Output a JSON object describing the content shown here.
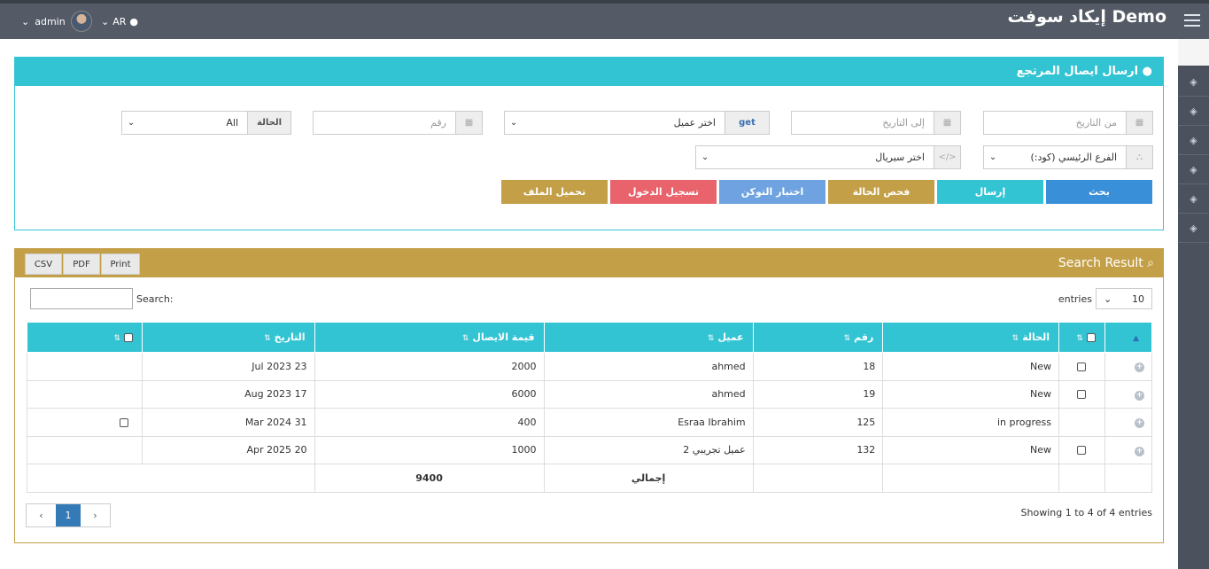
{
  "header": {
    "brand": "إيكاد سوفت Demo",
    "user": "admin",
    "lang": "AR"
  },
  "form": {
    "title": "ارسال ايصال المرتجع",
    "from_date_placeholder": "من التاريخ",
    "to_date_placeholder": "إلى التاريخ",
    "client_select": "اختر عميل",
    "get_label": "get",
    "number_placeholder": "رقم",
    "status_label": "الحالة",
    "status_value": "All",
    "branch_select": "الفرع الرئيسي (كود:)",
    "serial_select": "اختر سيريال",
    "buttons": {
      "search": "بحث",
      "send": "إرسال",
      "check_status": "فحص الحالة",
      "token_test": "اختبار التوكن",
      "login": "تسجيل الدخول",
      "upload_file": "تحميل الملف"
    }
  },
  "results": {
    "title": "Search Result",
    "export": {
      "csv": "CSV",
      "pdf": "PDF",
      "print": "Print"
    },
    "entries_label": "entries",
    "entries_value": "10",
    "search_label": "Search:",
    "columns": [
      "الحالة",
      "رقم",
      "عميل",
      "قيمة الايصال",
      "التاريخ"
    ],
    "rows": [
      {
        "status": "New",
        "number": "18",
        "client": "ahmed",
        "amount": "2000",
        "date": "23 Jul 2023"
      },
      {
        "status": "New",
        "number": "19",
        "client": "ahmed",
        "amount": "6000",
        "date": "17 Aug 2023"
      },
      {
        "status": "in progress",
        "number": "125",
        "client": "Esraa Ibrahim",
        "amount": "400",
        "date": "31 Mar 2024"
      },
      {
        "status": "New",
        "number": "132",
        "client": "عميل تجريبي 2",
        "amount": "1000",
        "date": "20 Apr 2025"
      }
    ],
    "total_label": "إجمالي",
    "total_value": "9400",
    "showing": "Showing 1 to 4 of 4 entries",
    "page": "1"
  },
  "colors": {
    "cyan": "#33c4d4",
    "gold": "#c39f47",
    "blue": "#3a8fd9",
    "red": "#e8636b",
    "lightblue": "#6ea2e0"
  }
}
